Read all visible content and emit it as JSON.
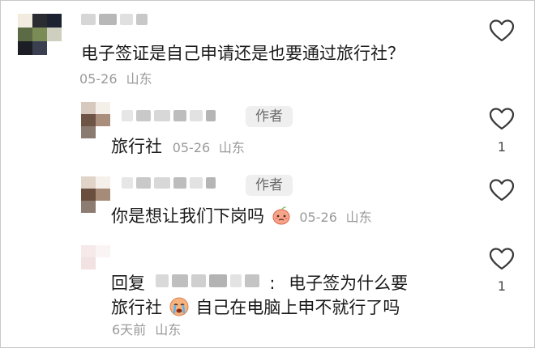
{
  "author_badge": "作者",
  "comments": [
    {
      "text": "电子签证是自己申请还是也要通过旅行社？",
      "date": "05-26",
      "location": "山东"
    },
    {
      "text": "旅行社",
      "date": "05-26",
      "location": "山东",
      "likes": "1"
    },
    {
      "text": "你是想让我们下岗吗",
      "date": "05-26",
      "location": "山东"
    },
    {
      "reply_prefix": "回复",
      "reply_sep": ":",
      "text_part1": "电子签为什么要",
      "text_part2a": "旅行社",
      "text_part2b": "自己在电脑上申不就行了吗",
      "time": "6天前",
      "location": "山东",
      "likes": "1"
    }
  ],
  "icons": {
    "like": "heart-outline-icon",
    "emoji_peach": "peach-face-emoji",
    "emoji_cry": "crying-face-emoji"
  }
}
